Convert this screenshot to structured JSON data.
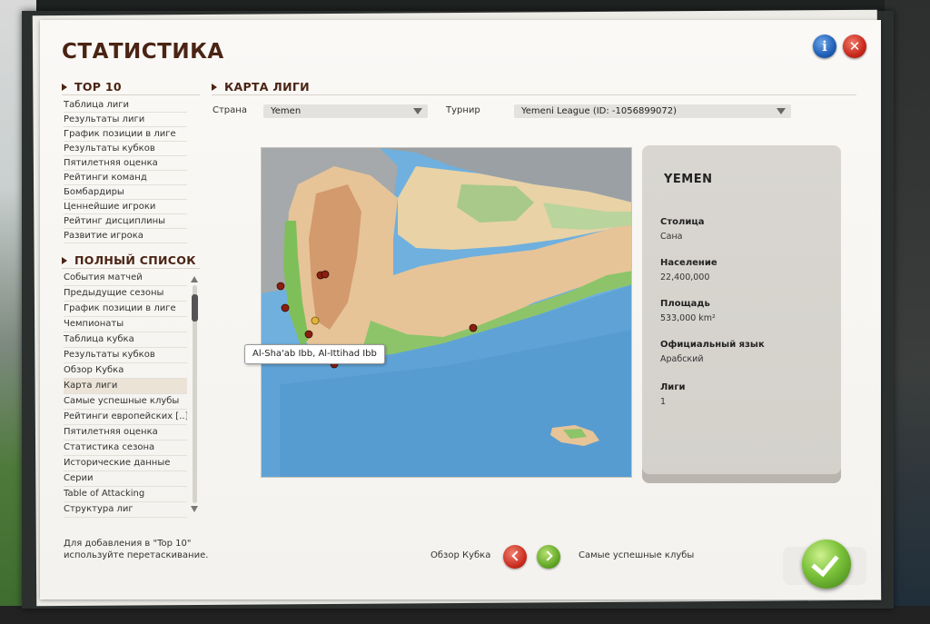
{
  "window": {
    "title": "СТАТИСТИКА"
  },
  "colors": {
    "title": "#4a2414",
    "info_button": "#1f5fb8",
    "close_button": "#c8291c",
    "confirm_button": "#5ea522"
  },
  "icons": {
    "info": "info-icon",
    "close": "close-icon",
    "prev": "chevron-left-icon",
    "next": "chevron-right-icon",
    "confirm": "checkmark-icon"
  },
  "info_button_glyph": "i",
  "close_button_glyph": "✕",
  "top10": {
    "heading": "TOP 10",
    "items": [
      "Таблица лиги",
      "Результаты лиги",
      "График позиции в лиге",
      "Результаты кубков",
      "Пятилетняя оценка",
      "Рейтинги команд",
      "Бомбардиры",
      "Ценнейшие игроки",
      "Рейтинг дисциплины",
      "Развитие игрока"
    ]
  },
  "full_list": {
    "heading": "ПОЛНЫЙ СПИСОК",
    "items": [
      "События матчей",
      "Предыдущие сезоны",
      "График позиции в лиге",
      "Чемпионаты",
      "Таблица кубка",
      "Результаты кубков",
      "Обзор Кубка",
      "Карта лиги",
      "Самые успешные клубы",
      "Рейтинги европейских [..]",
      "Пятилетняя оценка",
      "Статистика сезона",
      "Исторические данные",
      "Серии",
      "Table of Attacking",
      "Структура лиг"
    ],
    "selected": "Карта лиги"
  },
  "hint": {
    "line1": "Для добавления в \"Top 10\"",
    "line2": "используйте перетаскивание."
  },
  "league_map": {
    "heading": "КАРТА ЛИГИ",
    "country_label": "Страна",
    "country_value": "Yemen",
    "tournament_label": "Турнир",
    "tournament_value": "Yemeni League (ID: -1056899072)",
    "tooltip": "Al-Sha'ab Ibb, Al-Ittihad Ibb"
  },
  "country_info": {
    "name": "YEMEN",
    "capital_label": "Столица",
    "capital_value": "Сана",
    "population_label": "Население",
    "population_value": "22,400,000",
    "area_label": "Площадь",
    "area_value": "533,000 km²",
    "language_label": "Официальный язык",
    "language_value": "Арабский",
    "leagues_label": "Лиги",
    "leagues_value": "1"
  },
  "navigation": {
    "prev_label": "Обзор Кубка",
    "next_label": "Самые успешные клубы"
  }
}
